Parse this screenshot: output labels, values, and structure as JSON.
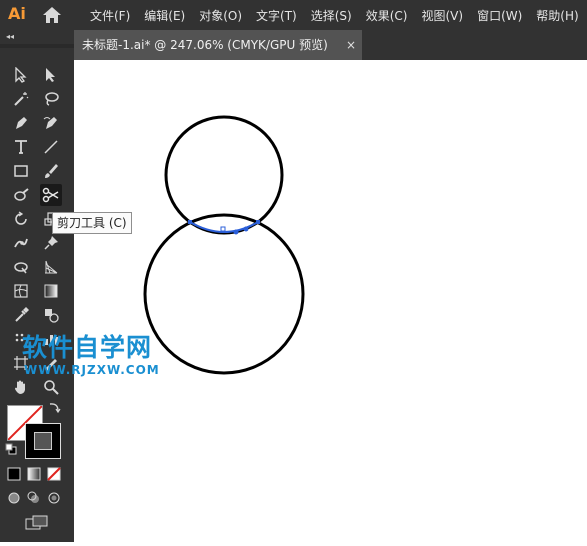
{
  "app": {
    "logo_text": "Ai"
  },
  "menu": [
    "文件(F)",
    "编辑(E)",
    "对象(O)",
    "文字(T)",
    "选择(S)",
    "效果(C)",
    "视图(V)",
    "窗口(W)",
    "帮助(H)"
  ],
  "document_tab": {
    "title": "未标题-1.ai* @ 247.06% (CMYK/GPU 预览)",
    "close_glyph": "×"
  },
  "toolbar": {
    "collapse_glyph": "◂◂"
  },
  "tooltip": {
    "text": "剪刀工具 (C)"
  },
  "watermark": {
    "chinese": "软件自学网",
    "url": "WWW.RJZXW.COM"
  },
  "colors": {
    "chrome": "#323232",
    "tab": "#535353",
    "watermark": "#1a8fd1",
    "accent": "#f79a36",
    "selection": "#2b5fd9"
  }
}
